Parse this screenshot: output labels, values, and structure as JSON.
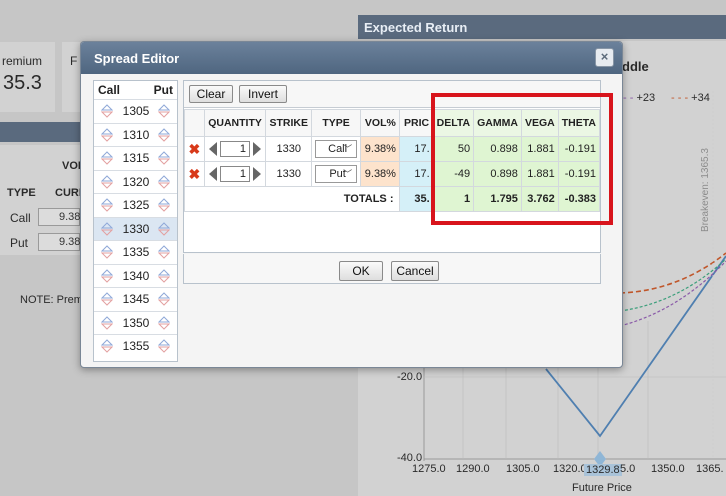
{
  "background": {
    "premium_label": "remium",
    "premium_value": "35.3",
    "left_letter": "F",
    "vol_label": "VOL",
    "type_label": "TYPE",
    "curr_label": "CURF",
    "rows": [
      {
        "type": "Call",
        "value": "9.38"
      },
      {
        "type": "Put",
        "value": "9.38"
      }
    ],
    "note": "NOTE: Prem",
    "expected_return": "Expected Return",
    "chart_title_frag": "ddle",
    "legend": [
      "+23",
      "+34"
    ],
    "breakeven": "Breakeven: 1365.3",
    "y_ticks": [
      "-20.0",
      "-40.0"
    ],
    "x_ticks": [
      "1275.0",
      "1290.0",
      "1305.0",
      "1320.0",
      "1329.8",
      "5.0",
      "1350.0",
      "1365."
    ],
    "x_axis_label": "Future Price"
  },
  "modal": {
    "title": "Spread Editor",
    "close_label": "×",
    "strike_list": {
      "call_label": "Call",
      "put_label": "Put",
      "strikes": [
        "1305",
        "1310",
        "1315",
        "1320",
        "1325",
        "1330",
        "1335",
        "1340",
        "1345",
        "1350",
        "1355"
      ],
      "selected": "1330"
    },
    "toolbar": {
      "clear_label": "Clear",
      "invert_label": "Invert"
    },
    "columns": {
      "quantity": "QUANTITY",
      "strike": "STRIKE",
      "type": "TYPE",
      "vol": "VOL%",
      "price": "PRIC",
      "delta": "DELTA",
      "gamma": "GAMMA",
      "vega": "VEGA",
      "theta": "THETA"
    },
    "legs": [
      {
        "quantity": "1",
        "strike": "1330",
        "type": "Call",
        "vol": "9.38%",
        "price": "17.",
        "delta": "50",
        "gamma": "0.898",
        "vega": "1.881",
        "theta": "-0.191"
      },
      {
        "quantity": "1",
        "strike": "1330",
        "type": "Put",
        "vol": "9.38%",
        "price": "17.",
        "delta": "-49",
        "gamma": "0.898",
        "vega": "1.881",
        "theta": "-0.191"
      }
    ],
    "totals": {
      "label": "TOTALS :",
      "price": "35.",
      "delta": "1",
      "gamma": "1.795",
      "vega": "3.762",
      "theta": "-0.383"
    },
    "ok_label": "OK",
    "cancel_label": "Cancel"
  }
}
